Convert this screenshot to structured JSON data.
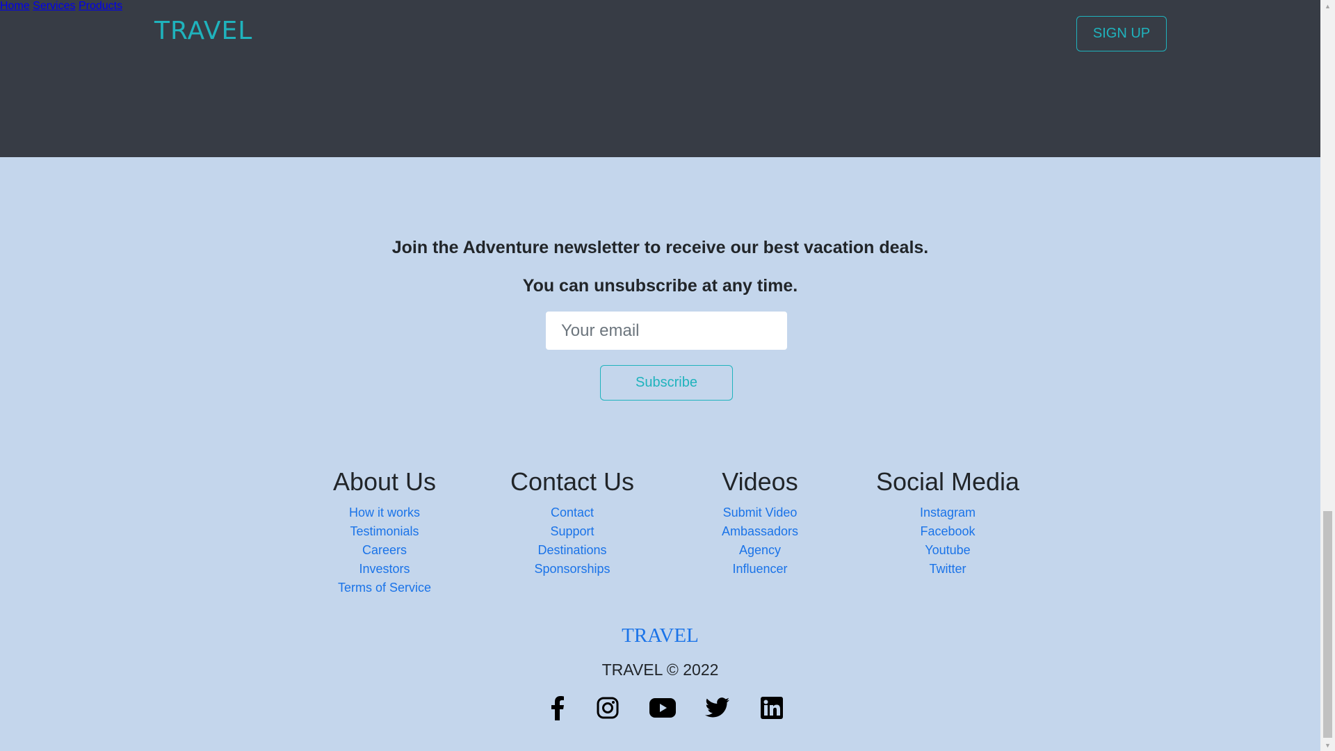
{
  "header": {
    "logo": "TRAVEL",
    "nav": [
      {
        "label": "Home"
      },
      {
        "label": "Services"
      },
      {
        "label": "Products"
      }
    ],
    "signup_label": "SIGN UP",
    "colors": {
      "background": "#373c45",
      "accent": "#1fb3bd"
    }
  },
  "newsletter": {
    "line1": "Join the Adventure newsletter to receive our best vacation deals.",
    "line2": "You can unsubscribe at any time.",
    "email_placeholder": "Your email",
    "subscribe_label": "Subscribe"
  },
  "footer": {
    "columns": [
      {
        "title": "About Us",
        "links": [
          "How it works",
          "Testimonials",
          "Careers",
          "Investors",
          "Terms of Service"
        ]
      },
      {
        "title": "Contact Us",
        "links": [
          "Contact",
          "Support",
          "Destinations",
          "Sponsorships"
        ]
      },
      {
        "title": "Videos",
        "links": [
          "Submit Video",
          "Ambassadors",
          "Agency",
          "Influencer"
        ]
      },
      {
        "title": "Social Media",
        "links": [
          "Instagram",
          "Facebook",
          "Youtube",
          "Twitter"
        ]
      }
    ],
    "logo": "TRAVEL",
    "copyright": "TRAVEL © 2022",
    "social_icons": [
      "facebook-icon",
      "instagram-icon",
      "youtube-icon",
      "twitter-icon",
      "linkedin-icon"
    ],
    "colors": {
      "background": "#c4d6ec",
      "link": "#1a73e8"
    }
  }
}
